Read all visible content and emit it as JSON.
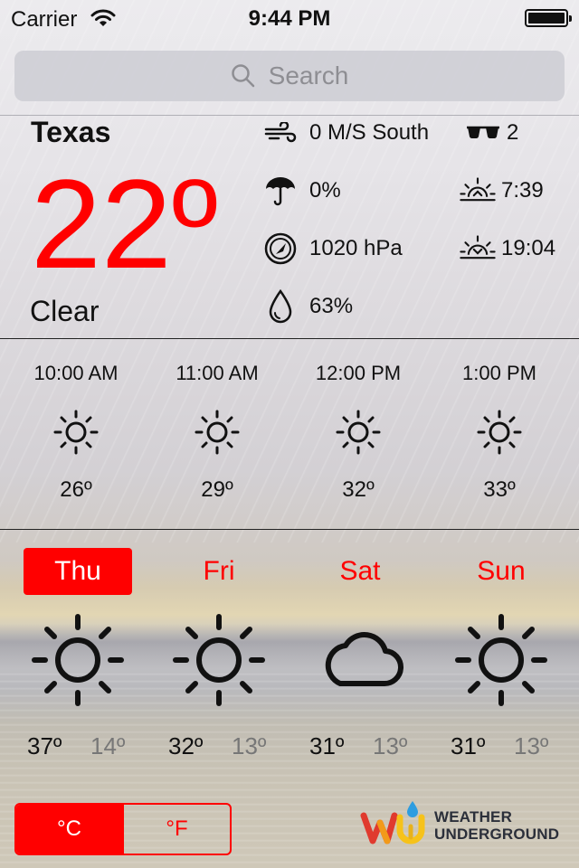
{
  "status_bar": {
    "carrier": "Carrier",
    "time": "9:44 PM"
  },
  "search": {
    "placeholder": "Search"
  },
  "current": {
    "city": "Texas",
    "temperature": "22º",
    "condition": "Clear",
    "wind": "0 M/S South",
    "uv_index": "2",
    "precipitation": "0%",
    "sunrise": "7:39",
    "pressure": "1020 hPa",
    "sunset": "19:04",
    "humidity": "63%"
  },
  "hourly": [
    {
      "time": "10:00 AM",
      "icon": "sun-icon",
      "temp": "26º"
    },
    {
      "time": "11:00 AM",
      "icon": "sun-icon",
      "temp": "29º"
    },
    {
      "time": "12:00 PM",
      "icon": "sun-icon",
      "temp": "32º"
    },
    {
      "time": "1:00 PM",
      "icon": "sun-icon",
      "temp": "33º"
    }
  ],
  "daily": [
    {
      "day": "Thu",
      "icon": "sun-icon",
      "high": "37º",
      "low": "14º",
      "selected": true
    },
    {
      "day": "Fri",
      "icon": "sun-icon",
      "high": "32º",
      "low": "13º",
      "selected": false
    },
    {
      "day": "Sat",
      "icon": "cloud-icon",
      "high": "31º",
      "low": "13º",
      "selected": false
    },
    {
      "day": "Sun",
      "icon": "sun-icon",
      "high": "31º",
      "low": "13º",
      "selected": false
    }
  ],
  "units": {
    "celsius": "°C",
    "fahrenheit": "°F",
    "selected": "celsius"
  },
  "logo": {
    "line1": "WEATHER",
    "line2": "UNDERGROUND"
  },
  "colors": {
    "accent": "#ff0000",
    "text": "#111111",
    "muted": "#777777"
  }
}
